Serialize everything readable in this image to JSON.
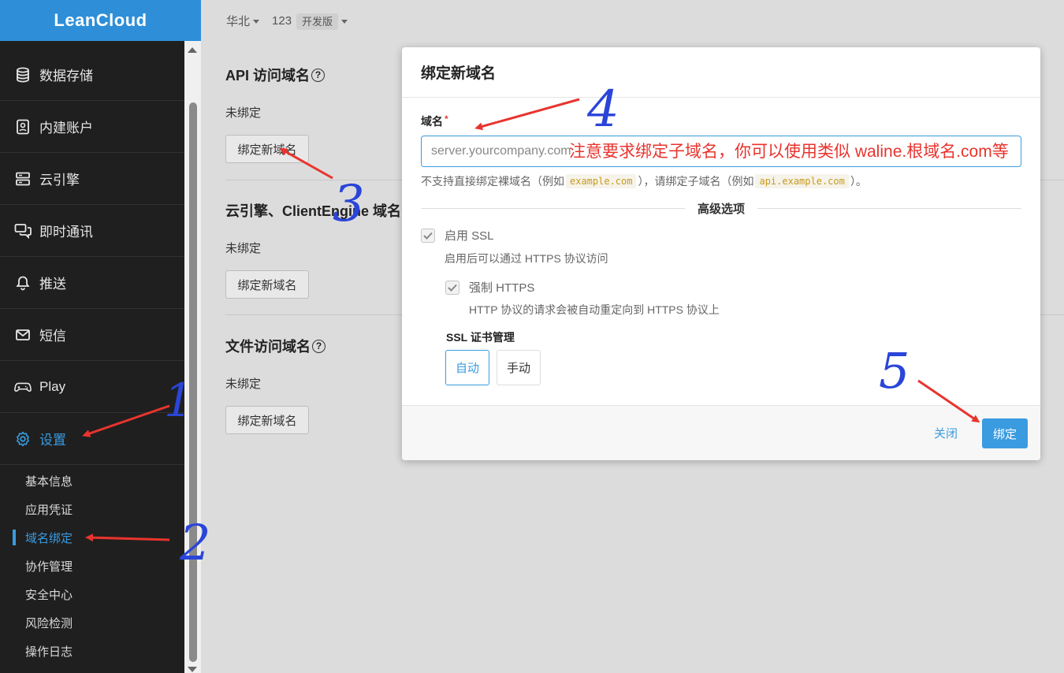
{
  "app": {
    "logo": "LeanCloud"
  },
  "topbar": {
    "region": "华北",
    "app_name": "123",
    "plan_badge": "开发版"
  },
  "sidebar": {
    "items": [
      {
        "label": "数据存储",
        "icon": "database-icon"
      },
      {
        "label": "内建账户",
        "icon": "id-card-icon"
      },
      {
        "label": "云引擎",
        "icon": "server-icon"
      },
      {
        "label": "即时通讯",
        "icon": "chat-icon"
      },
      {
        "label": "推送",
        "icon": "bell-icon"
      },
      {
        "label": "短信",
        "icon": "mail-icon"
      },
      {
        "label": "Play",
        "icon": "gamepad-icon"
      },
      {
        "label": "设置",
        "icon": "gear-icon",
        "active": true
      }
    ],
    "sub_items": [
      {
        "label": "基本信息"
      },
      {
        "label": "应用凭证"
      },
      {
        "label": "域名绑定",
        "active": true
      },
      {
        "label": "协作管理"
      },
      {
        "label": "安全中心"
      },
      {
        "label": "风险检测"
      },
      {
        "label": "操作日志"
      }
    ]
  },
  "main": {
    "sections": [
      {
        "title": "API 访问域名",
        "status": "未绑定",
        "button": "绑定新域名"
      },
      {
        "title": "云引擎、ClientEngine 域名",
        "status": "未绑定",
        "button": "绑定新域名"
      },
      {
        "title": "文件访问域名",
        "status": "未绑定",
        "button": "绑定新域名"
      }
    ]
  },
  "modal": {
    "title": "绑定新域名",
    "field_label": "域名",
    "required_mark": "*",
    "input_placeholder": "server.yourcompany.com",
    "input_value": "",
    "overlay_note": "注意要求绑定子域名，你可以使用类似 waline.根域名.com等",
    "hint_prefix": "不支持直接绑定裸域名（例如",
    "hint_code1": "example.com",
    "hint_middle": "），请绑定子域名（例如",
    "hint_code2": "api.example.com",
    "hint_suffix": "）。",
    "advanced_label": "高级选项",
    "ssl_label": "启用 SSL",
    "ssl_hint": "启用后可以通过 HTTPS 协议访问",
    "force_https_label": "强制 HTTPS",
    "force_https_hint": "HTTP 协议的请求会被自动重定向到 HTTPS 协议上",
    "ssl_cert_title": "SSL 证书管理",
    "cert_auto": "自动",
    "cert_manual": "手动",
    "close_label": "关闭",
    "confirm_label": "绑定"
  },
  "annotations": {
    "step1": "1",
    "step2": "2",
    "step3": "3",
    "step4": "4",
    "step5": "5"
  },
  "colors": {
    "accent": "#3a9be0",
    "logo_bg": "#2e8fd8",
    "sidebar_bg": "#1f1f1f",
    "arrow_red": "#e8342e",
    "pen_blue": "#2a45d8"
  }
}
